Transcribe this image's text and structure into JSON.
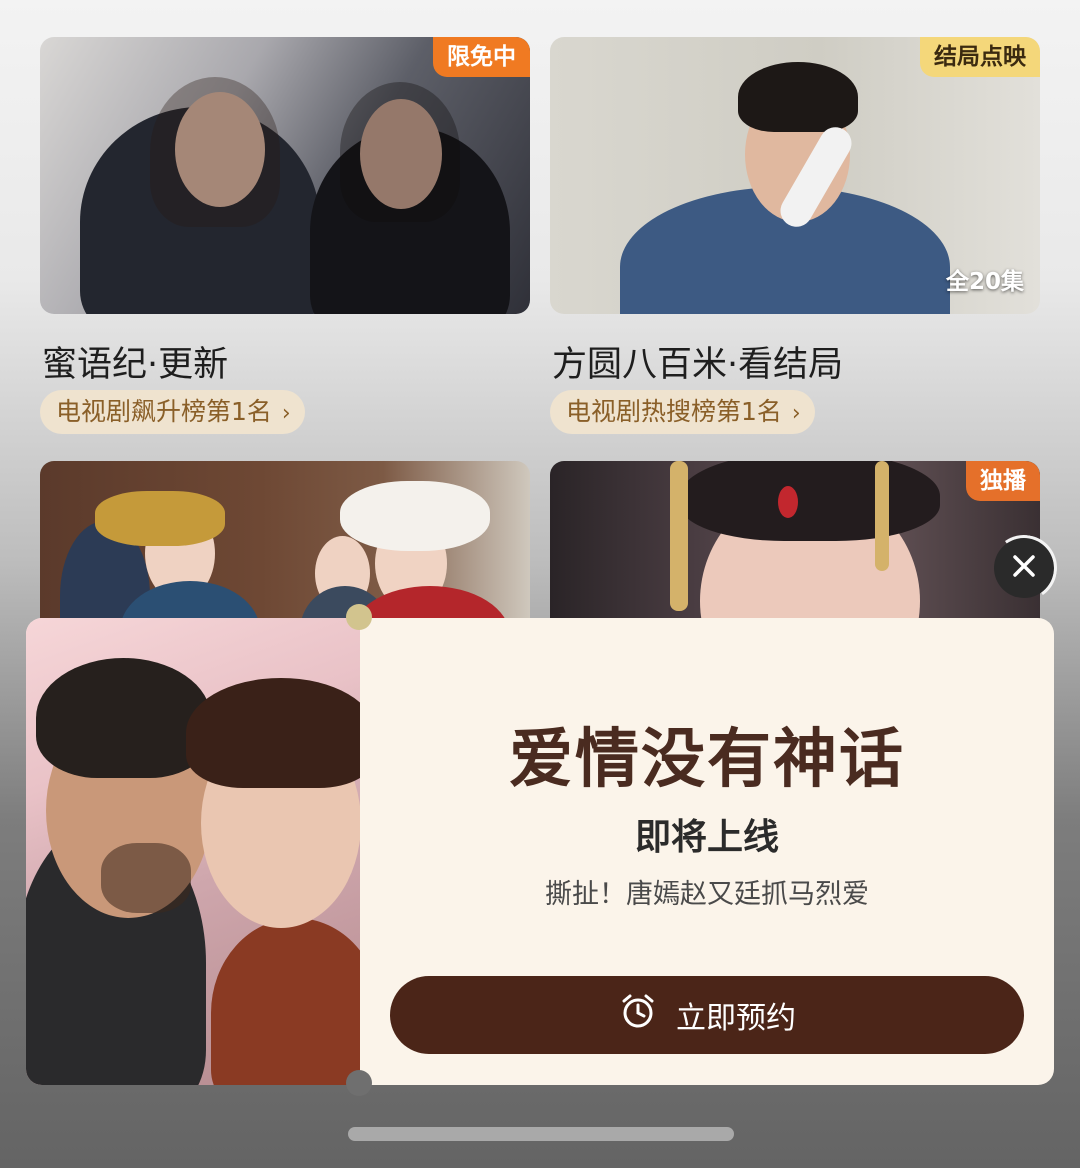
{
  "grid": {
    "cards": [
      {
        "title": "蜜语纪·更新",
        "tag": "限免中",
        "tag_color": "#f07a22",
        "rank": "电视剧飙升榜第1名"
      },
      {
        "title": "方圆八百米·看结局",
        "tag": "结局点映",
        "tag_color": "#f4d77a",
        "episodes": "全20集",
        "rank": "电视剧热搜榜第1名"
      },
      {
        "title": "",
        "tag": ""
      },
      {
        "title": "",
        "tag": "独播",
        "tag_color": "#e5702a"
      }
    ],
    "rank_chevron": "›"
  },
  "popup": {
    "title": "爱情没有神话",
    "subtitle": "即将上线",
    "description": "撕扯！唐嫣赵又廷抓马烈爱",
    "button_label": "立即预约",
    "button_icon": "alarm-clock-icon",
    "close_icon": "close-icon",
    "accent_color": "#4b2518",
    "background_color": "#fbf4ea"
  }
}
